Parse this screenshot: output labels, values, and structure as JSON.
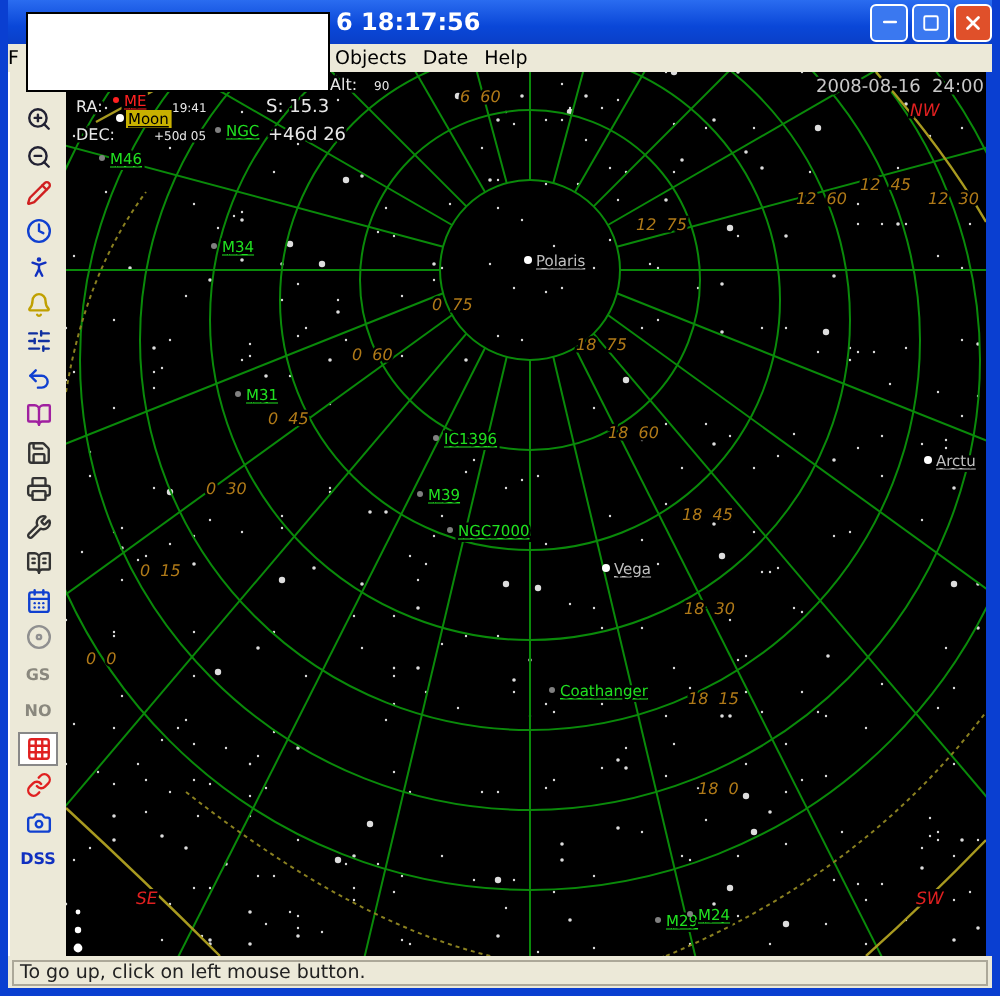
{
  "window": {
    "title": "6 18:17:56"
  },
  "menu": [
    {
      "label": "F"
    },
    {
      "label": "Objects"
    },
    {
      "label": "Date"
    },
    {
      "label": "Help"
    }
  ],
  "toolbar": [
    {
      "kind": "zoom-in",
      "pressed": false
    },
    {
      "kind": "zoom-out",
      "pressed": false
    },
    {
      "kind": "pencil",
      "pressed": false
    },
    {
      "kind": "clock",
      "pressed": false
    },
    {
      "kind": "walker",
      "pressed": false
    },
    {
      "kind": "bell",
      "pressed": false
    },
    {
      "kind": "sliders",
      "pressed": false
    },
    {
      "kind": "undo",
      "pressed": false
    },
    {
      "kind": "book",
      "pressed": false
    },
    {
      "kind": "save",
      "pressed": false
    },
    {
      "kind": "print",
      "pressed": false
    },
    {
      "kind": "wrench",
      "pressed": false
    },
    {
      "kind": "atlas",
      "pressed": false
    },
    {
      "kind": "calendar",
      "pressed": false
    },
    {
      "kind": "disc",
      "pressed": false
    },
    {
      "kind": "text",
      "label": "GS",
      "disabled": true,
      "pressed": false
    },
    {
      "kind": "text",
      "label": "NO",
      "disabled": true,
      "pressed": false
    },
    {
      "kind": "grid",
      "pressed": true
    },
    {
      "kind": "link",
      "pressed": false
    },
    {
      "kind": "camera",
      "pressed": false
    },
    {
      "kind": "text",
      "label": "DSS",
      "disabled": false,
      "pressed": false
    }
  ],
  "info": [
    {
      "kind": "label",
      "text": "RA:"
    },
    {
      "kind": "small",
      "text": "19:41"
    },
    {
      "kind": "value",
      "text": "S: 15.3"
    },
    {
      "kind": "label",
      "text": "DEC:"
    },
    {
      "kind": "small",
      "text": "+50d 05"
    },
    {
      "kind": "value",
      "text": "+46d 26"
    },
    {
      "kind": "label",
      "text": "Alt:"
    },
    {
      "kind": "small",
      "text": "90"
    },
    {
      "kind": "value",
      "text": "2008-08-16  24:00"
    }
  ],
  "objects": [
    {
      "label": "ME",
      "kind": "planet"
    },
    {
      "label": "Moon",
      "kind": "moon"
    },
    {
      "label": "M46",
      "kind": "cluster"
    },
    {
      "label": "NGC",
      "kind": "cluster"
    },
    {
      "label": "M34",
      "kind": "cluster"
    },
    {
      "label": "M31",
      "kind": "galaxy"
    },
    {
      "label": "Polaris",
      "kind": "star"
    },
    {
      "label": "IC1396",
      "kind": "nebula"
    },
    {
      "label": "M39",
      "kind": "cluster"
    },
    {
      "label": "NGC7000",
      "kind": "nebula"
    },
    {
      "label": "Vega",
      "kind": "star"
    },
    {
      "label": "Coathanger",
      "kind": "cluster"
    },
    {
      "label": "Arctu",
      "kind": "star"
    },
    {
      "label": "M29",
      "kind": "cluster"
    },
    {
      "label": "M24",
      "kind": "cluster"
    }
  ],
  "grid_labels": [
    "6  60",
    "12  75",
    "12  60",
    "12  45",
    "12  30",
    "0  75",
    "0  60",
    "0  45",
    "0  30",
    "0  15",
    "0  0",
    "18  75",
    "18  60",
    "18  45",
    "18  30",
    "18  15",
    "18  0"
  ],
  "directions": [
    "NW",
    "SE",
    "SW"
  ],
  "status_bar": "To go up, click on left mouse button."
}
